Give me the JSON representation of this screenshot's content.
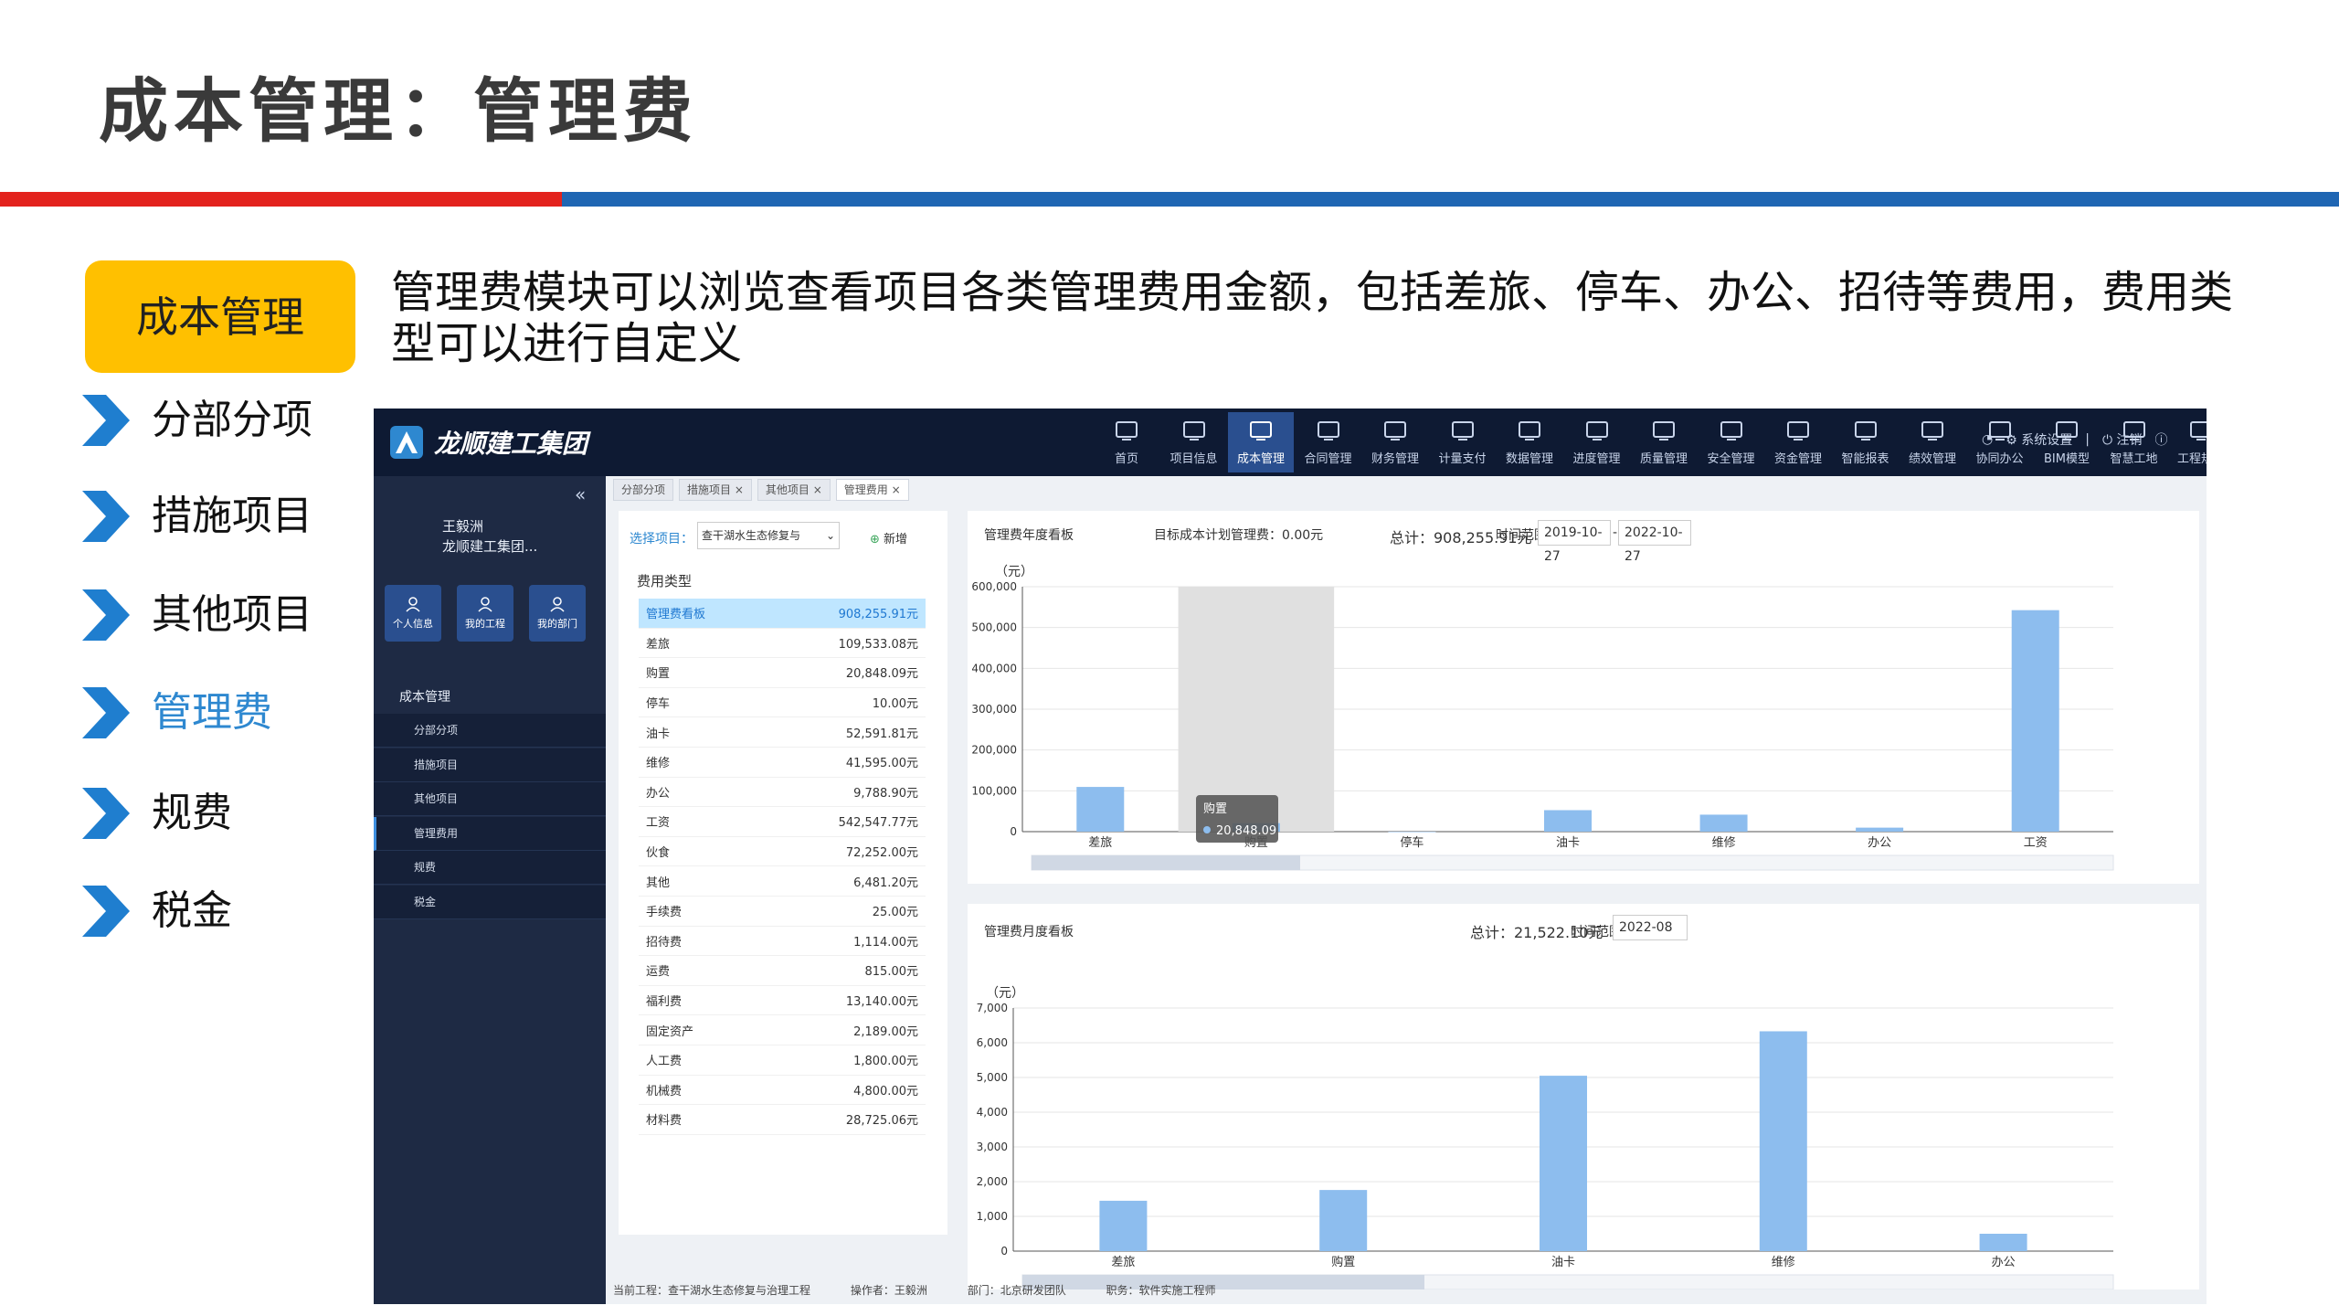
{
  "title": "成本管理：管理费",
  "section_badge": "成本管理",
  "nav": [
    {
      "label": "分部分项",
      "active": false
    },
    {
      "label": "措施项目",
      "active": false
    },
    {
      "label": "其他项目",
      "active": false
    },
    {
      "label": "管理费",
      "active": true
    },
    {
      "label": "规费",
      "active": false
    },
    {
      "label": "税金",
      "active": false
    }
  ],
  "intro": "管理费模块可以浏览查看项目各类管理费用金额，包括差旅、停车、办公、招待等费用，费用类型可以进行自定义",
  "app": {
    "logo_text": "龙顺建工集团",
    "top_menu": [
      {
        "label": "首页",
        "icon": "monitor-icon"
      },
      {
        "label": "项目信息",
        "icon": "helmet-icon"
      },
      {
        "label": "成本管理",
        "icon": "factory-icon",
        "active": true
      },
      {
        "label": "合同管理",
        "icon": "chart-icon"
      },
      {
        "label": "财务管理",
        "icon": "finance-icon"
      },
      {
        "label": "计量支付",
        "icon": "pay-icon"
      },
      {
        "label": "数据管理",
        "icon": "data-icon"
      },
      {
        "label": "进度管理",
        "icon": "progress-icon"
      },
      {
        "label": "质量管理",
        "icon": "quality-icon"
      },
      {
        "label": "安全管理",
        "icon": "safety-icon"
      },
      {
        "label": "资金管理",
        "icon": "fund-icon"
      },
      {
        "label": "智能报表",
        "icon": "report-icon"
      },
      {
        "label": "绩效管理",
        "icon": "kpi-icon"
      },
      {
        "label": "协同办公",
        "icon": "office-icon"
      },
      {
        "label": "BIM模型",
        "icon": "bim-icon"
      },
      {
        "label": "智慧工地",
        "icon": "site-icon"
      },
      {
        "label": "工程规范",
        "icon": "spec-icon"
      }
    ],
    "top_right": {
      "settings": "系统设置",
      "logout": "注销"
    },
    "user": {
      "name": "王毅洲",
      "org": "龙顺建工集团..."
    },
    "quick_links": [
      "个人信息",
      "我的工程",
      "我的部门"
    ],
    "menu_head": "成本管理",
    "submenu": [
      {
        "label": "分部分项"
      },
      {
        "label": "措施项目"
      },
      {
        "label": "其他项目"
      },
      {
        "label": "管理费用",
        "active": true
      },
      {
        "label": "规费"
      },
      {
        "label": "税金"
      }
    ],
    "tabs": [
      {
        "label": "分部分项"
      },
      {
        "label": "措施项目 ×"
      },
      {
        "label": "其他项目 ×"
      },
      {
        "label": "管理费用 ×",
        "active": true
      }
    ],
    "project_label": "选择项目：",
    "project_value": "查干湖水生态修复与",
    "add_button": "新增",
    "fee_type_head": "费用类型",
    "fee_rows": [
      {
        "name": "管理费看板",
        "amount": "908,255.91元",
        "selected": true
      },
      {
        "name": "差旅",
        "amount": "109,533.08元"
      },
      {
        "name": "购置",
        "amount": "20,848.09元"
      },
      {
        "name": "停车",
        "amount": "10.00元"
      },
      {
        "name": "油卡",
        "amount": "52,591.81元"
      },
      {
        "name": "维修",
        "amount": "41,595.00元"
      },
      {
        "name": "办公",
        "amount": "9,788.90元"
      },
      {
        "name": "工资",
        "amount": "542,547.77元"
      },
      {
        "name": "伙食",
        "amount": "72,252.00元"
      },
      {
        "name": "其他",
        "amount": "6,481.20元"
      },
      {
        "name": "手续费",
        "amount": "25.00元"
      },
      {
        "name": "招待费",
        "amount": "1,114.00元"
      },
      {
        "name": "运费",
        "amount": "815.00元"
      },
      {
        "name": "福利费",
        "amount": "13,140.00元"
      },
      {
        "name": "固定资产",
        "amount": "2,189.00元"
      },
      {
        "name": "人工费",
        "amount": "1,800.00元"
      },
      {
        "name": "机械费",
        "amount": "4,800.00元"
      },
      {
        "name": "材料费",
        "amount": "28,725.06元"
      }
    ],
    "chart1_header": {
      "title": "管理费年度看板",
      "target": "目标成本计划管理费：0.00元",
      "total": "总计：908,255.91元",
      "range_label": "时间范围：",
      "start": "2019-10-27",
      "sep": "-",
      "end": "2022-10-27"
    },
    "chart2_header": {
      "title": "管理费月度看板",
      "total": "总计：21,522.10元",
      "range_label": "时间范围：",
      "month": "2022-08"
    },
    "tooltip": {
      "name": "购置",
      "value": "20,848.09"
    },
    "footer": {
      "project": "当前工程：查干湖水生态修复与治理工程",
      "operator": "操作者：王毅洲",
      "dept": "部门：北京研发团队",
      "role": "职务：软件实施工程师"
    }
  },
  "colors": {
    "bar": "#8dbdee",
    "accent": "#2e88d0",
    "badge": "#ffc000",
    "red": "#e3231d",
    "blue": "#1f66b3"
  },
  "chart_data": [
    {
      "type": "bar",
      "title": "管理费年度看板",
      "ylabel": "（元）",
      "categories": [
        "差旅",
        "购置",
        "停车",
        "油卡",
        "维修",
        "办公",
        "工资"
      ],
      "values": [
        109533.08,
        20848.09,
        10,
        52591.81,
        41595,
        9788.9,
        542547.77
      ],
      "ylim": [
        0,
        600000
      ],
      "yticks": [
        "600,000",
        "500,000",
        "400,000",
        "300,000",
        "200,000",
        "100,000",
        "0"
      ],
      "highlight_index": 1
    },
    {
      "type": "bar",
      "title": "管理费月度看板",
      "ylabel": "（元）",
      "categories": [
        "差旅",
        "购置",
        "油卡",
        "维修",
        "办公"
      ],
      "values": [
        1450,
        1760,
        5050,
        6330,
        500
      ],
      "ylim": [
        0,
        7000
      ],
      "yticks": [
        "7,000",
        "6,000",
        "5,000",
        "4,000",
        "3,000",
        "2,000",
        "1,000",
        "0"
      ]
    }
  ]
}
